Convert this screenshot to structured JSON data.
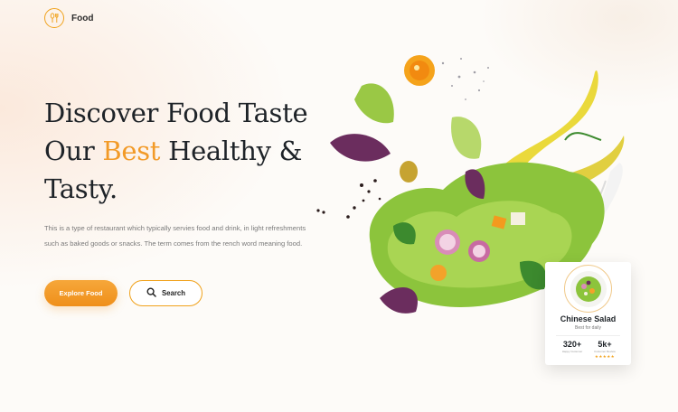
{
  "nav": {
    "logo_text": "Food"
  },
  "hero": {
    "headline_line1": "Discover Food Taste",
    "headline_line2_prefix": "Our ",
    "headline_accent": "Best",
    "headline_line2_suffix": " Healthy &",
    "headline_line3": "Tasty.",
    "description": "This is a type of restaurant which typically servies food and drink, in light refreshments such as baked goods or snacks. The term comes from the rench word meaning food."
  },
  "buttons": {
    "explore_label": "Explore Food",
    "search_label": "Search"
  },
  "card": {
    "title": "Chinese Salad",
    "subtitle": "Best for daily",
    "stats": [
      {
        "value": "320+",
        "label": "Happy Customer"
      },
      {
        "value": "5k+",
        "label": "Customer Review",
        "stars": "★★★★★"
      }
    ]
  },
  "colors": {
    "accent": "#f29a27",
    "dark": "#1e2328",
    "muted": "#7a7a7a"
  },
  "icons": {
    "logo": "fork-spoon-icon",
    "search": "search-icon"
  }
}
